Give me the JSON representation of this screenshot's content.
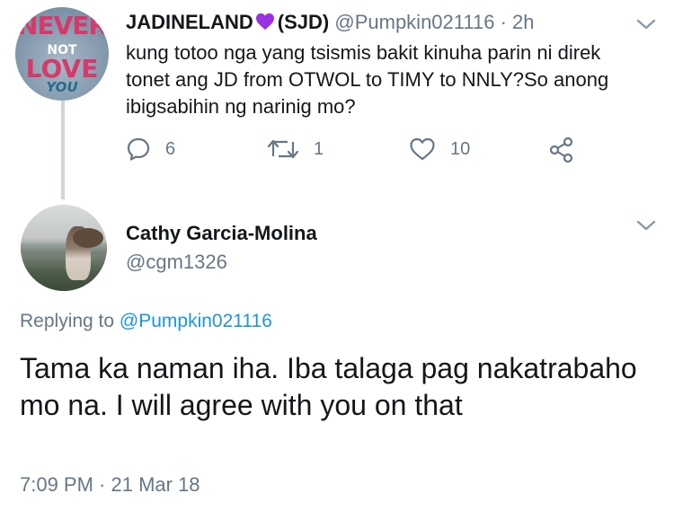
{
  "tweet1": {
    "avatar_text": [
      "NEVER",
      "NOT",
      "LOVE",
      "YOU"
    ],
    "display_name": "JADINELAND",
    "name_suffix": "(SJD)",
    "handle": "@Pumpkin021116",
    "time": "· 2h",
    "text": "kung totoo nga yang tsismis bakit kinuha parin ni direk tonet ang JD from OTWOL to TIMY to NNLY?So anong ibigsabihin ng narinig mo?",
    "replies": "6",
    "retweets": "1",
    "likes": "10",
    "icons": [
      "reply-icon",
      "retweet-icon",
      "like-icon",
      "share-icon",
      "purple-heart-icon",
      "chevron-down-icon"
    ]
  },
  "tweet2": {
    "display_name": "Cathy Garcia-Molina",
    "handle": "@cgm1326",
    "replying_label": "Replying to",
    "replying_handle": "@Pumpkin021116",
    "text": "Tama ka naman iha. Iba talaga pag nakatrabaho mo na. I will agree with you on that",
    "timestamp": "7:09 PM · 21 Mar 18"
  },
  "colors": {
    "text": "#14171a",
    "secondary": "#657786",
    "link": "#1b95e0",
    "thread_line": "#ccd6dd",
    "heart_emoji": "#9b30e0"
  }
}
